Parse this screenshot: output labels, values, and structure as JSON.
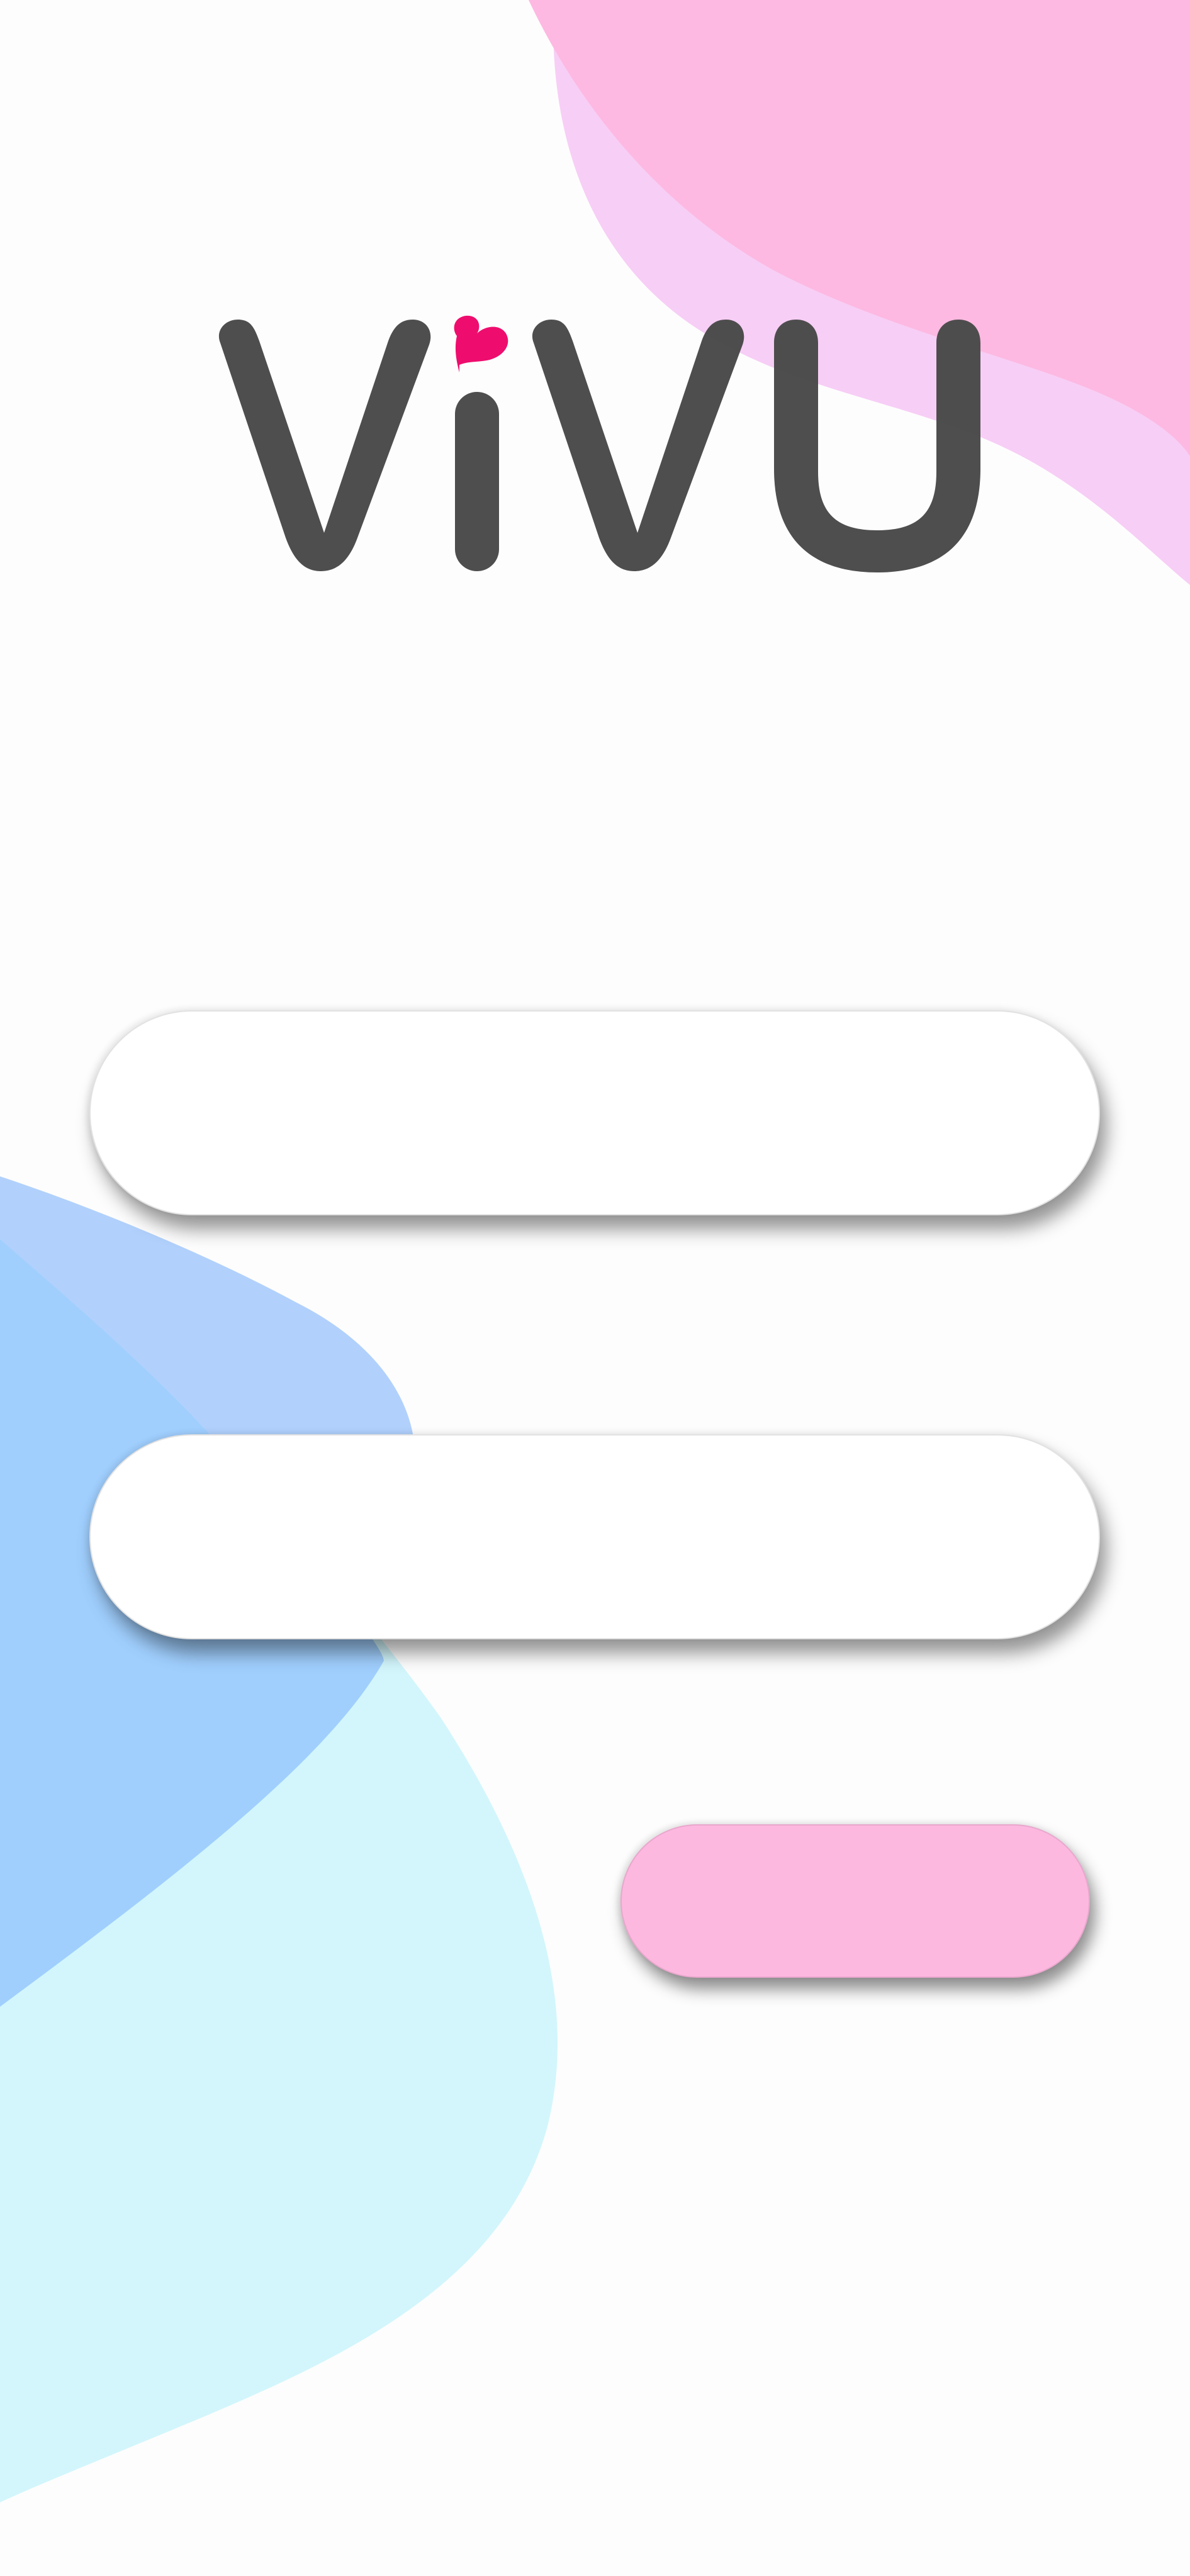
{
  "app": {
    "logo_text": "ViVU",
    "logo_accent_icon": "heart-icon"
  },
  "colors": {
    "logo_text": "#4a4a4a",
    "logo_heart": "#ee0d6e",
    "blob_pink_top": "#fdb9e1",
    "blob_lilac_top": "#f7cef6",
    "blob_blue": "#a0cffe",
    "blob_blue_light": "#b1d1fc",
    "blob_cyan": "#d2f6fc",
    "button_fill": "#fdb8e0",
    "field_fill": "#ffffff"
  },
  "form": {
    "field_1": {
      "value": "",
      "placeholder": ""
    },
    "field_2": {
      "value": "",
      "placeholder": ""
    },
    "submit_label": ""
  }
}
